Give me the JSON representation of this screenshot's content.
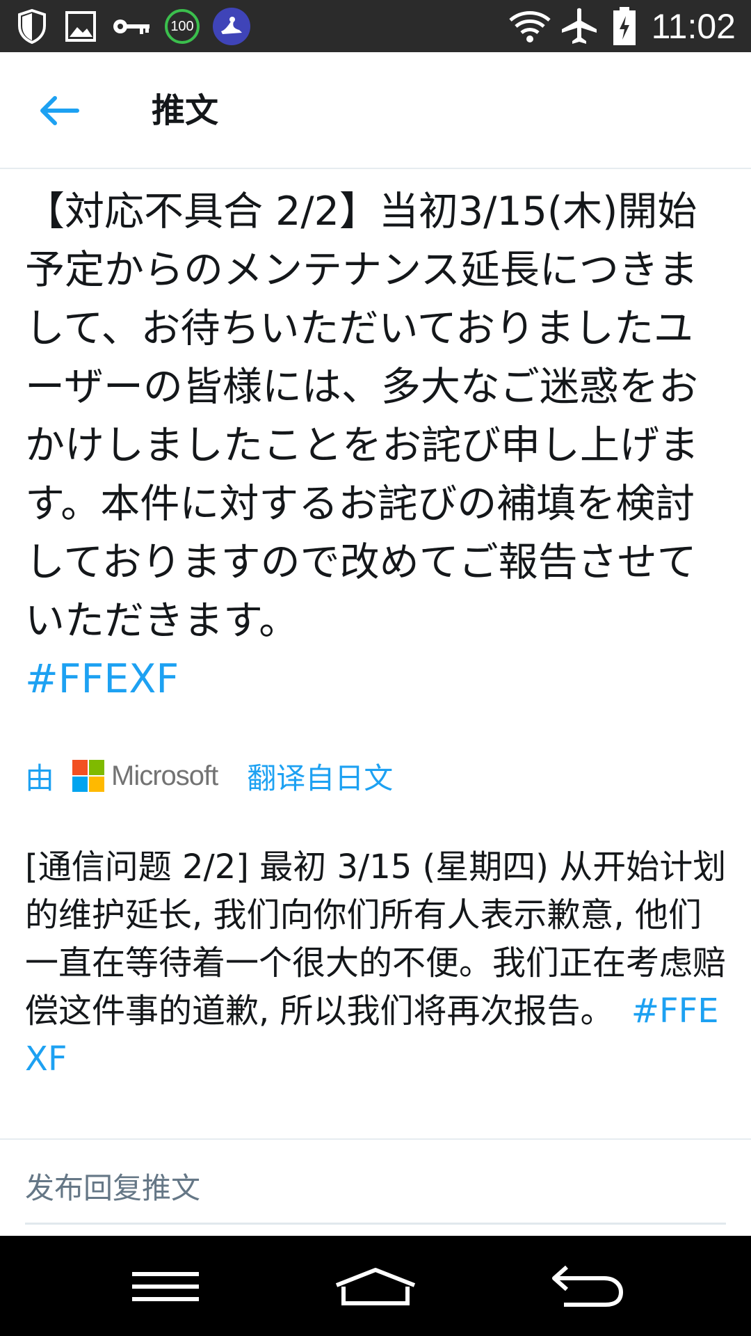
{
  "status_bar": {
    "time": "11:02",
    "battery_badge": "100",
    "icons": [
      "shield-icon",
      "image-icon",
      "key-icon",
      "battery-saver-icon",
      "app-notification-icon",
      "wifi-icon",
      "airplane-mode-icon",
      "battery-charging-icon"
    ]
  },
  "header": {
    "title": "推文"
  },
  "tweet": {
    "text": "【対応不具合 2/2】当初3/15(木)開始予定からのメンテナンス延長につきまして、お待ちいただいておりましたユーザーの皆様には、多大なご迷惑をおかけしましたことをお詫び申し上げます。本件に対するお詫びの補填を検討しておりますので改めてご報告させていただきます。",
    "hashtag": "#FFEXF"
  },
  "translation": {
    "by_label": "由",
    "provider": "Microsoft",
    "translated_from": "翻译自日文",
    "text": "[通信问题 2/2] 最初 3/15 (星期四) 从开始计划的维护延长, 我们向你们所有人表示歉意, 他们一直在等待着一个很大的不便。我们正在考虑赔偿这件事的道歉, 所以我们将再次报告。",
    "hashtag": "#FFEXF"
  },
  "reply": {
    "placeholder": "发布回复推文"
  },
  "colors": {
    "accent": "#1da1f2",
    "status_bar": "#2b2b2b",
    "nav_bar": "#000000",
    "text": "#14171a",
    "placeholder": "#657786"
  },
  "nav": {
    "icons": [
      "menu-icon",
      "home-icon",
      "back-icon"
    ]
  }
}
